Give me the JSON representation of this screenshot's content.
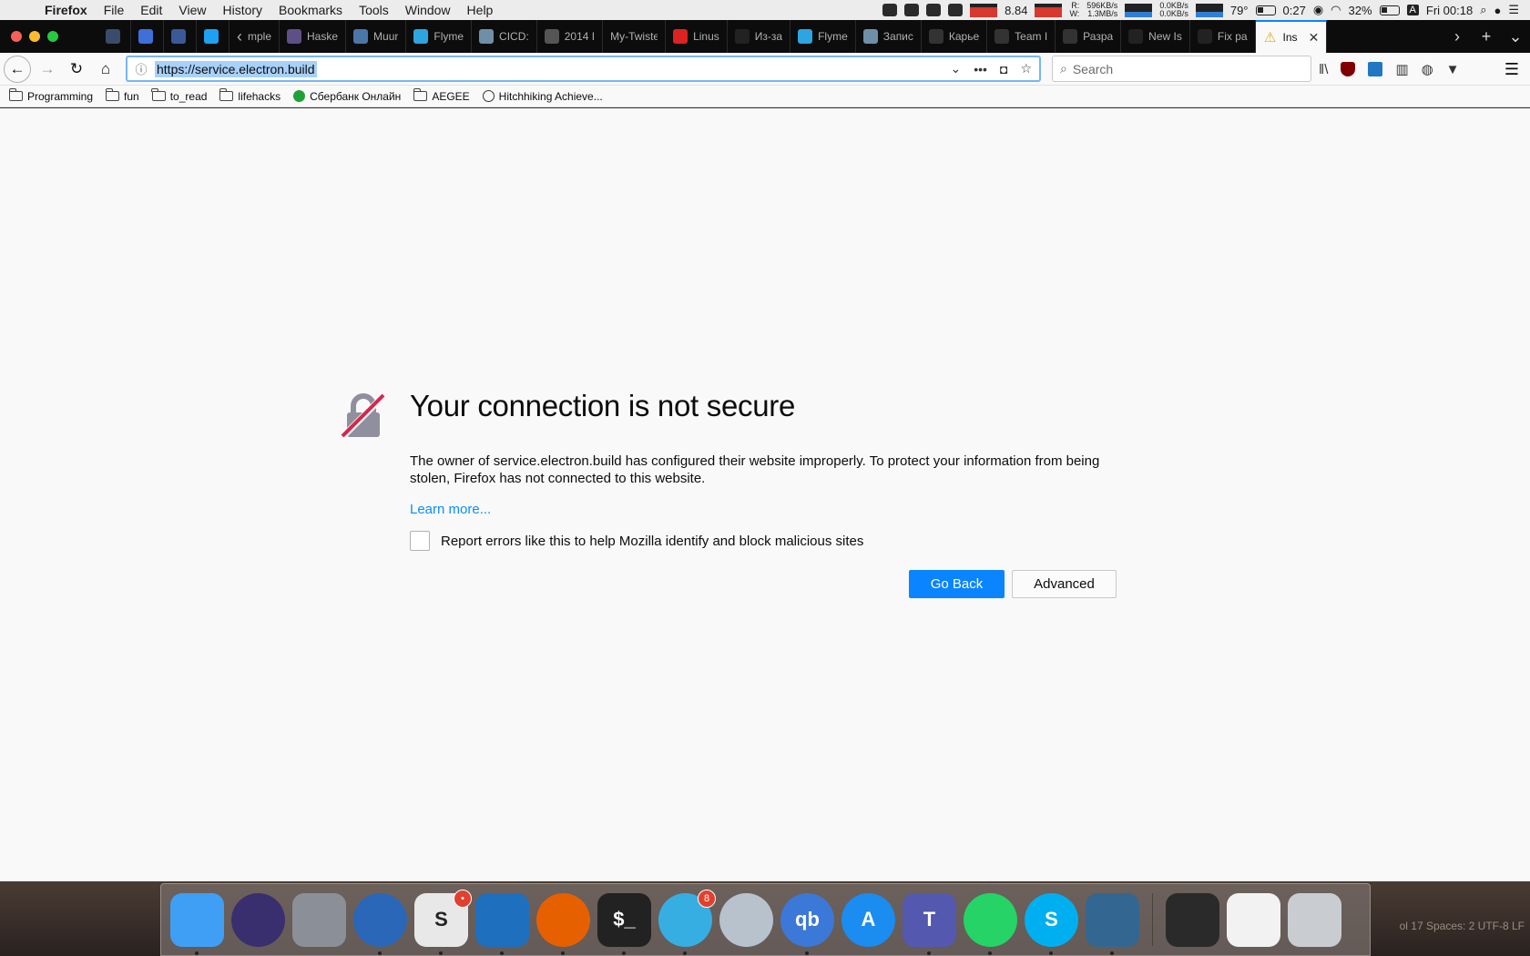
{
  "menubar": {
    "items": [
      "Firefox",
      "File",
      "Edit",
      "View",
      "History",
      "Bookmarks",
      "Tools",
      "Window",
      "Help"
    ],
    "cpu_load": "8.84",
    "disk_read_label": "R:",
    "disk_write_label": "W:",
    "disk_read": "596KB/s",
    "disk_write": "1.3MB/s",
    "net_up": "0.0KB/s",
    "net_down": "0.0KB/s",
    "temperature": "79°",
    "battery_time": "0:27",
    "battery_percent": "32%",
    "input_source": "A",
    "clock": "Fri 00:18"
  },
  "tabs": [
    {
      "title": "",
      "icon": "video-icon",
      "color": "#3a4b6b"
    },
    {
      "title": "",
      "icon": "chat-icon",
      "color": "#3f6fd8"
    },
    {
      "title": "",
      "icon": "facebook-icon",
      "color": "#3b5998"
    },
    {
      "title": "",
      "icon": "twitter-icon",
      "color": "#1da1f2"
    },
    {
      "title": "mple",
      "icon": "",
      "color": ""
    },
    {
      "title": "Haske",
      "icon": "haskell-icon",
      "color": "#5e5086"
    },
    {
      "title": "Muur",
      "icon": "vk-icon",
      "color": "#4a76a8"
    },
    {
      "title": "Flyme",
      "icon": "telegram-icon",
      "color": "#2ca5e0"
    },
    {
      "title": "CICD:",
      "icon": "habr-icon",
      "color": "#6f8fa8"
    },
    {
      "title": "2014 I",
      "icon": "shield-icon",
      "color": "#555"
    },
    {
      "title": "My-Twiste",
      "icon": "",
      "color": ""
    },
    {
      "title": "Linus",
      "icon": "t-icon",
      "color": "#d22"
    },
    {
      "title": "Из-за",
      "icon": "q-icon",
      "color": "#222"
    },
    {
      "title": "Flyme",
      "icon": "telegram-icon",
      "color": "#2ca5e0"
    },
    {
      "title": "Запис",
      "icon": "habr-icon",
      "color": "#6f8fa8"
    },
    {
      "title": "Карье",
      "icon": "cloud-icon",
      "color": "#333"
    },
    {
      "title": "Team I",
      "icon": "cloud-icon",
      "color": "#333"
    },
    {
      "title": "Разра",
      "icon": "cloud-icon",
      "color": "#333"
    },
    {
      "title": "New Is",
      "icon": "github-icon",
      "color": "#222"
    },
    {
      "title": "Fix pa",
      "icon": "github-icon",
      "color": "#222"
    },
    {
      "title": "Ins",
      "icon": "warning-icon",
      "color": "#f0c000"
    }
  ],
  "urlbar": {
    "url": "https://service.electron.build"
  },
  "searchbar": {
    "placeholder": "Search"
  },
  "bookmarks": [
    {
      "label": "Programming",
      "icon": "folder-icon"
    },
    {
      "label": "fun",
      "icon": "folder-icon"
    },
    {
      "label": "to_read",
      "icon": "folder-icon"
    },
    {
      "label": "lifehacks",
      "icon": "folder-icon"
    },
    {
      "label": "Сбербанк Онлайн",
      "icon": "sberbank-icon"
    },
    {
      "label": "AEGEE",
      "icon": "folder-icon"
    },
    {
      "label": "Hitchhiking Achieve...",
      "icon": "hitchhiking-icon"
    }
  ],
  "error": {
    "title": "Your connection is not secure",
    "description": "The owner of service.electron.build has configured their website improperly. To protect your information from being stolen, Firefox has not connected to this website.",
    "learn_more": "Learn more...",
    "report_label": "Report errors like this to help Mozilla identify and block malicious sites",
    "go_back": "Go Back",
    "advanced": "Advanced"
  },
  "status_text": "ol 17   Spaces: 2   UTF-8   LF",
  "dock": {
    "apps": [
      {
        "name": "finder",
        "label": "",
        "color": "#3e9ff5",
        "running": true
      },
      {
        "name": "siri",
        "label": "",
        "color": "#3a2f6e",
        "running": false
      },
      {
        "name": "launchpad",
        "label": "",
        "color": "#8a8f98",
        "running": false
      },
      {
        "name": "thunderbird",
        "label": "",
        "color": "#2a67b8",
        "running": true
      },
      {
        "name": "slack",
        "label": "S",
        "color": "#e8e8e8",
        "running": true,
        "badge": "•"
      },
      {
        "name": "vscode",
        "label": "",
        "color": "#1f6fbf",
        "running": true
      },
      {
        "name": "firefox",
        "label": "",
        "color": "#e66000",
        "running": true
      },
      {
        "name": "terminal",
        "label": "$_",
        "color": "#222",
        "running": true
      },
      {
        "name": "telegram",
        "label": "",
        "color": "#37aee2",
        "running": true,
        "badge": "8"
      },
      {
        "name": "keychain",
        "label": "",
        "color": "#b8c2cc",
        "running": false
      },
      {
        "name": "qbittorrent",
        "label": "qb",
        "color": "#3c78d8",
        "running": true
      },
      {
        "name": "app-store",
        "label": "A",
        "color": "#1b8cf0",
        "running": false
      },
      {
        "name": "teams",
        "label": "T",
        "color": "#5558af",
        "running": true
      },
      {
        "name": "whatsapp",
        "label": "",
        "color": "#25d366",
        "running": true
      },
      {
        "name": "skype",
        "label": "S",
        "color": "#00aff0",
        "running": true
      },
      {
        "name": "postgres",
        "label": "",
        "color": "#336791",
        "running": true
      }
    ]
  }
}
